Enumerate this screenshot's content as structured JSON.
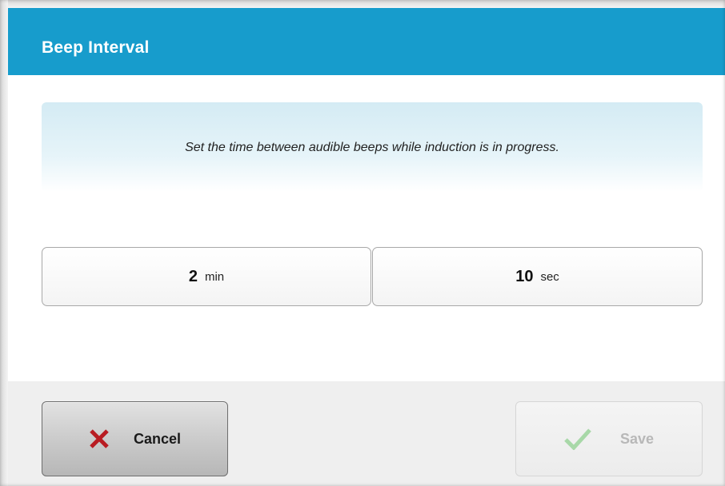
{
  "dialog": {
    "title": "Beep Interval"
  },
  "info": {
    "text": "Set the time between audible beeps while induction is in progress."
  },
  "interval": {
    "minutes": {
      "value": "2",
      "unit": "min"
    },
    "seconds": {
      "value": "10",
      "unit": "sec"
    }
  },
  "footer": {
    "cancel": {
      "label": "Cancel",
      "icon": "close-x-icon",
      "icon_color": "#b81c22"
    },
    "save": {
      "label": "Save",
      "icon": "checkmark-icon",
      "icon_color": "#a8d8a8",
      "enabled": false
    }
  },
  "colors": {
    "header": "#179ccc",
    "footer": "#efefef"
  }
}
